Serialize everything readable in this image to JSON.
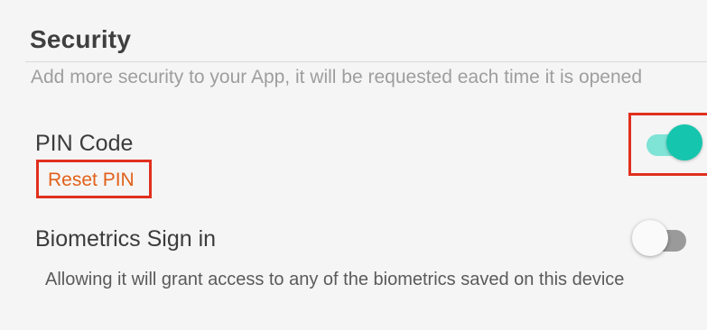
{
  "security": {
    "title": "Security",
    "description": "Add more security to your App, it will be requested each time it is opened"
  },
  "pin_code": {
    "label": "PIN Code",
    "enabled": true,
    "reset_link": "Reset PIN"
  },
  "biometrics": {
    "label": "Biometrics Sign in",
    "enabled": false,
    "description": "Allowing it will grant access to any of the biometrics saved on this device"
  },
  "colors": {
    "toggle_on_thumb": "#16c5ae",
    "toggle_on_track": "#7fe3d6",
    "link": "#e2611a",
    "highlight_border": "#e0301e"
  }
}
